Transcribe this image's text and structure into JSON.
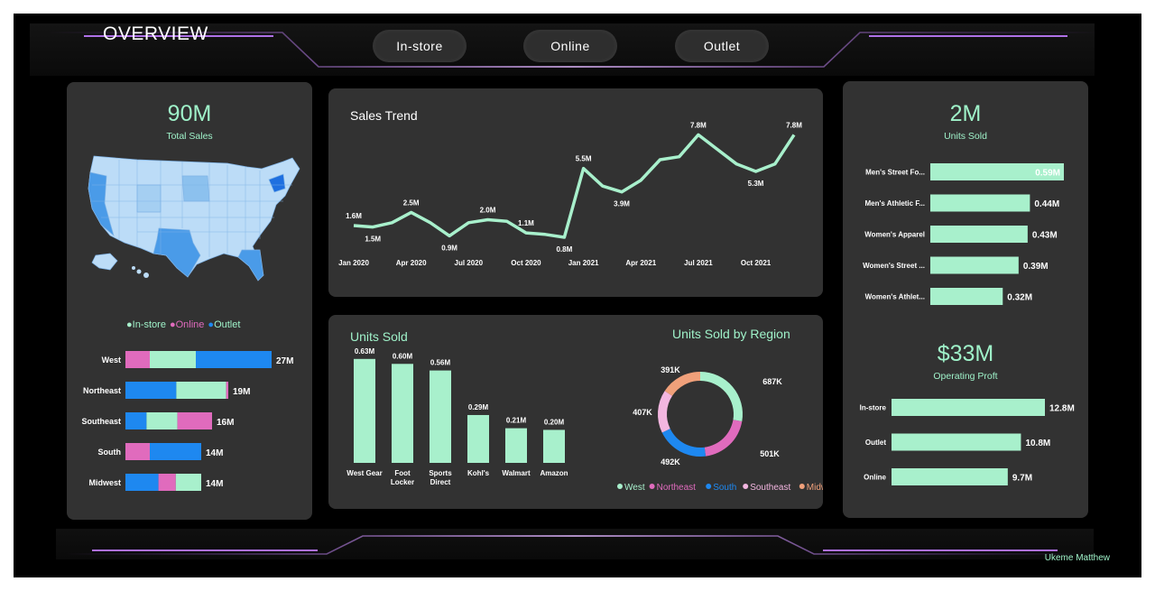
{
  "header": {
    "title": "OVERVIEW",
    "tabs": [
      {
        "label": "In-store"
      },
      {
        "label": "Online"
      },
      {
        "label": "Outlet"
      }
    ]
  },
  "colors": {
    "background": "#000000",
    "panel": "#323232",
    "accent_green": "#9ff2c9",
    "instore": "#a8f0cc",
    "online": "#e06bbd",
    "outlet": "#1e88f0",
    "glow_purple": "#c07bff"
  },
  "left_panel": {
    "total_sales_value": "90M",
    "total_sales_label": "Total Sales",
    "map_icon": "us-map-icon",
    "legend": [
      {
        "label": "In-store",
        "color": "#a8f0cc"
      },
      {
        "label": "Online",
        "color": "#e06bbd"
      },
      {
        "label": "Outlet",
        "color": "#1e88f0"
      }
    ],
    "region_chart": {
      "type": "bar",
      "stacked": true,
      "categories": [
        "West",
        "Northeast",
        "Southeast",
        "South",
        "Midwest"
      ],
      "totals_labels": [
        "27M",
        "19M",
        "16M",
        "14M",
        "14M"
      ],
      "series": [
        {
          "name": "In-store",
          "values": [
            8.5,
            9.2,
            5.7,
            0,
            4.7
          ]
        },
        {
          "name": "Online",
          "values": [
            4.5,
            0.4,
            6.4,
            4.5,
            3.2
          ]
        },
        {
          "name": "Outlet",
          "values": [
            14.0,
            9.4,
            3.9,
            9.5,
            6.1
          ]
        }
      ]
    }
  },
  "sales_trend": {
    "title": "Sales Trend",
    "chart_data": {
      "type": "line",
      "x_ticks": [
        "Jan 2020",
        "Apr 2020",
        "Jul 2020",
        "Oct 2020",
        "Jan 2021",
        "Apr 2021",
        "Jul 2021",
        "Oct 2021"
      ],
      "x": [
        "2020-01",
        "2020-02",
        "2020-03",
        "2020-04",
        "2020-05",
        "2020-06",
        "2020-07",
        "2020-08",
        "2020-09",
        "2020-10",
        "2020-11",
        "2020-12",
        "2021-01",
        "2021-02",
        "2021-03",
        "2021-04",
        "2021-05",
        "2021-06",
        "2021-07",
        "2021-08",
        "2021-09",
        "2021-10",
        "2021-11",
        "2021-12"
      ],
      "values": [
        1.6,
        1.5,
        1.8,
        2.5,
        1.8,
        0.9,
        1.8,
        2.0,
        1.9,
        1.1,
        1.0,
        0.8,
        5.5,
        4.3,
        3.9,
        4.7,
        6.1,
        6.3,
        7.8,
        6.8,
        5.8,
        5.3,
        5.8,
        7.8
      ],
      "labels": [
        {
          "i": 0,
          "text": "1.6M"
        },
        {
          "i": 1,
          "text": "1.5M"
        },
        {
          "i": 3,
          "text": "2.5M"
        },
        {
          "i": 5,
          "text": "0.9M"
        },
        {
          "i": 7,
          "text": "2.0M"
        },
        {
          "i": 9,
          "text": "1.1M"
        },
        {
          "i": 11,
          "text": "0.8M"
        },
        {
          "i": 12,
          "text": "5.5M"
        },
        {
          "i": 14,
          "text": "3.9M"
        },
        {
          "i": 18,
          "text": "7.8M"
        },
        {
          "i": 21,
          "text": "5.3M"
        },
        {
          "i": 23,
          "text": "7.8M"
        }
      ],
      "ylim": [
        0,
        8.5
      ]
    }
  },
  "units_by_retailer": {
    "title": "Units Sold",
    "chart_data": {
      "type": "bar",
      "categories": [
        "West Gear",
        "Foot Locker",
        "Sports Direct",
        "Kohl's",
        "Walmart",
        "Amazon"
      ],
      "category_lines": [
        [
          "West Gear"
        ],
        [
          "Foot",
          "Locker"
        ],
        [
          "Sports",
          "Direct"
        ],
        [
          "Kohl's"
        ],
        [
          "Walmart"
        ],
        [
          "Amazon"
        ]
      ],
      "values": [
        0.63,
        0.6,
        0.56,
        0.29,
        0.21,
        0.2
      ],
      "value_labels": [
        "0.63M",
        "0.60M",
        "0.56M",
        "0.29M",
        "0.21M",
        "0.20M"
      ],
      "ylim": [
        0,
        0.7
      ]
    }
  },
  "units_by_region": {
    "title": "Units Sold by Region",
    "chart_data": {
      "type": "pie",
      "donut": true,
      "categories": [
        "West",
        "Northeast",
        "South",
        "Southeast",
        "Midwest"
      ],
      "values": [
        687,
        501,
        492,
        407,
        391
      ],
      "value_labels": [
        "687K",
        "501K",
        "492K",
        "407K",
        "391K"
      ],
      "colors": [
        "#a8f0cc",
        "#e06bbd",
        "#1e88f0",
        "#f3b6e0",
        "#f0a07a"
      ]
    },
    "legend": [
      {
        "label": "West",
        "color": "#a8f0cc"
      },
      {
        "label": "Northeast",
        "color": "#e06bbd"
      },
      {
        "label": "South",
        "color": "#1e88f0"
      },
      {
        "label": "Southeast",
        "color": "#f3b6e0"
      },
      {
        "label": "Midwest",
        "color": "#f0a07a"
      }
    ]
  },
  "right_panel": {
    "units_sold_value": "2M",
    "units_sold_label": "Units Sold",
    "product_chart": {
      "type": "bar",
      "orientation": "horizontal",
      "categories": [
        "Men's Street Fo...",
        "Men's Athletic F...",
        "Women's Apparel",
        "Women's Street ...",
        "Women's Athlet..."
      ],
      "values": [
        0.59,
        0.44,
        0.43,
        0.39,
        0.32
      ],
      "value_labels": [
        "0.59M",
        "0.44M",
        "0.43M",
        "0.39M",
        "0.32M"
      ]
    },
    "profit_value": "$33M",
    "profit_label": "Operating Proft",
    "profit_chart": {
      "type": "bar",
      "orientation": "horizontal",
      "categories": [
        "In-store",
        "Outlet",
        "Online"
      ],
      "values": [
        12.8,
        10.8,
        9.7
      ],
      "value_labels": [
        "12.8M",
        "10.8M",
        "9.7M"
      ]
    }
  },
  "footer": {
    "signature": "Ukeme Matthew"
  }
}
